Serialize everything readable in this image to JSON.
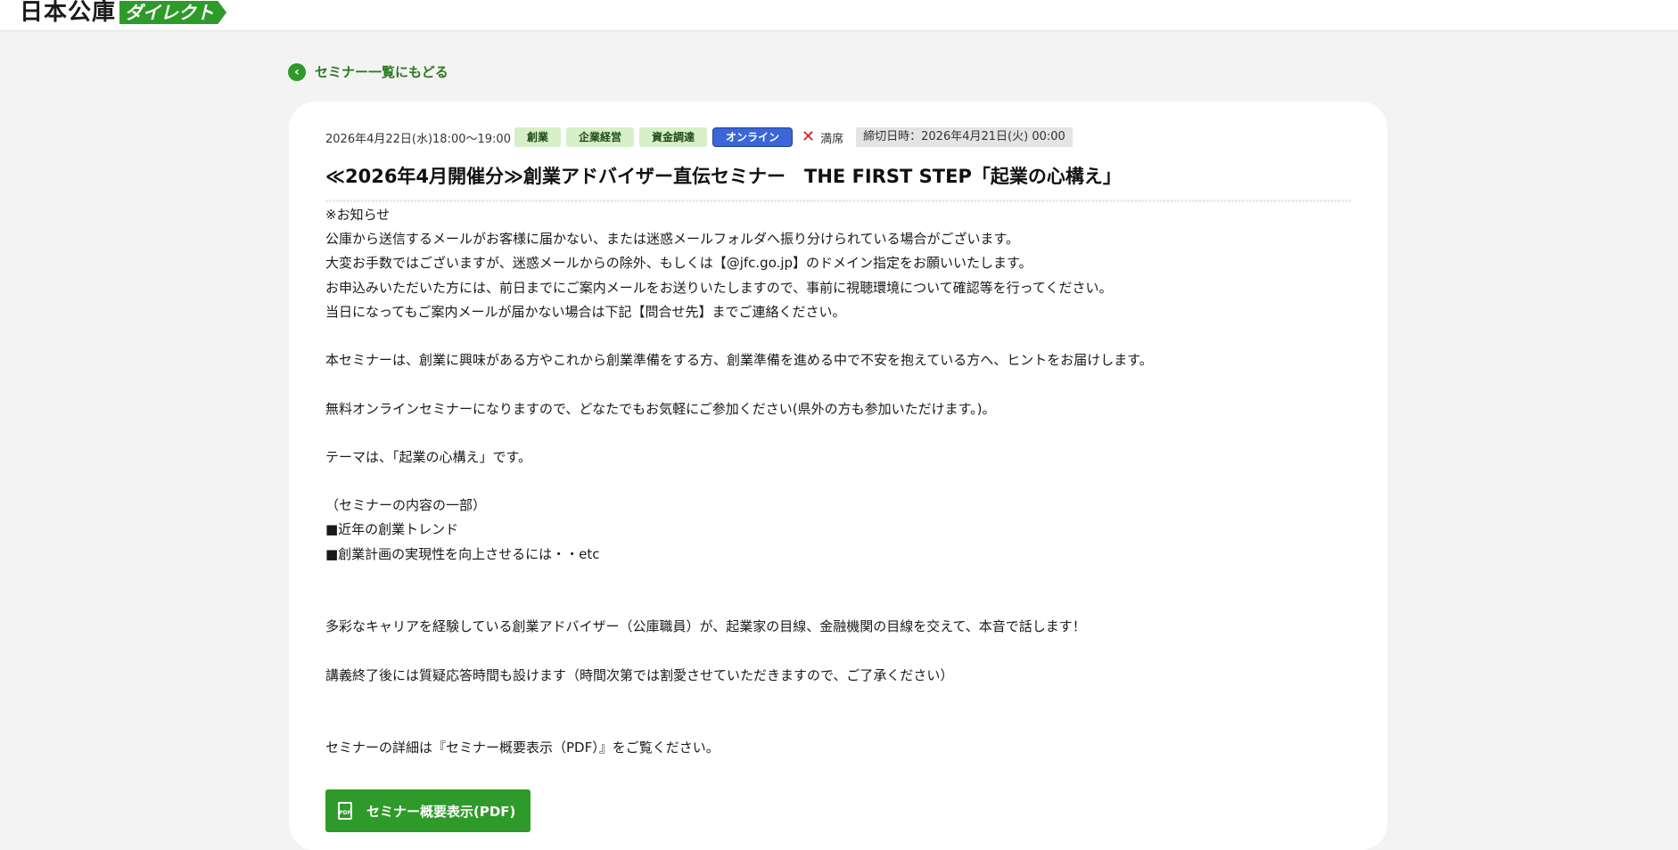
{
  "header": {
    "logo_main": "日本公庫",
    "logo_sub": "ダイレクト"
  },
  "back_link": {
    "icon": "chevron-left-icon",
    "label": "セミナー一覧にもどる"
  },
  "seminar": {
    "date": "2026年4月22日(水)18:00〜19:00",
    "tags": [
      "創業",
      "企業経営",
      "資金調達"
    ],
    "online_tag": "オンライン",
    "status_icon": "close-icon",
    "status": "満席",
    "deadline": "締切日時：2026年4月21日(火) 00:00",
    "title": "≪2026年4月開催分≫創業アドバイザー直伝セミナー　THE FIRST STEP「起業の心構え」",
    "body_lines": [
      "※お知らせ",
      "公庫から送信するメールがお客様に届かない、または迷惑メールフォルダへ振り分けられている場合がございます。",
      "大変お手数ではございますが、迷惑メールからの除外、もしくは【@jfc.go.jp】のドメイン指定をお願いいたします。",
      "お申込みいただいた方には、前日までにご案内メールをお送りいたしますので、事前に視聴環境について確認等を行ってください。",
      "当日になってもご案内メールが届かない場合は下記【問合せ先】までご連絡ください。",
      "",
      "本セミナーは、創業に興味がある方やこれから創業準備をする方、創業準備を進める中で不安を抱えている方へ、ヒントをお届けします。",
      "",
      "無料オンラインセミナーになりますので、どなたでもお気軽にご参加ください(県外の方も参加いただけます。)。",
      "",
      "テーマは、「起業の心構え」です。",
      "",
      "（セミナーの内容の一部）",
      "■近年の創業トレンド",
      "■創業計画の実現性を向上させるには・・etc",
      "",
      "",
      "多彩なキャリアを経験している創業アドバイザー（公庫職員）が、起業家の目線、金融機関の目線を交えて、本音で話します！",
      "",
      "講義終了後には質疑応答時間も設けます（時間次第では割愛させていただきますので、ご了承ください）",
      "",
      "",
      "セミナーの詳細は『セミナー概要表示（PDF）』をご覧ください。"
    ],
    "pdf_button": {
      "icon": "pdf-file-icon",
      "icon_text": "PDF",
      "label": "セミナー概要表示(PDF)"
    }
  },
  "colors": {
    "brand_green": "#2e9a2a",
    "tag_bg": "#d6efc9",
    "online_blue": "#3b66d8",
    "full_red": "#c8201a",
    "page_bg": "#f4f3f3"
  }
}
